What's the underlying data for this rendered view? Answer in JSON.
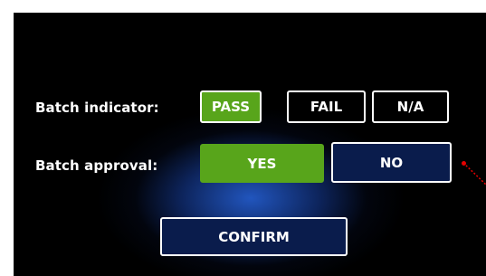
{
  "batch_indicator": {
    "label": "Batch indicator:",
    "options": [
      "PASS",
      "FAIL",
      "N/A"
    ],
    "selected": "PASS"
  },
  "batch_approval": {
    "label": "Batch approval:",
    "options": [
      "YES",
      "NO"
    ],
    "selected": "YES"
  },
  "confirm_label": "CONFIRM",
  "colors": {
    "screen_background": "#000000",
    "selected": "#58a51b",
    "confirm_button": "#0a1c4c",
    "glow": "#235ac8",
    "pointer": "#e60000"
  }
}
